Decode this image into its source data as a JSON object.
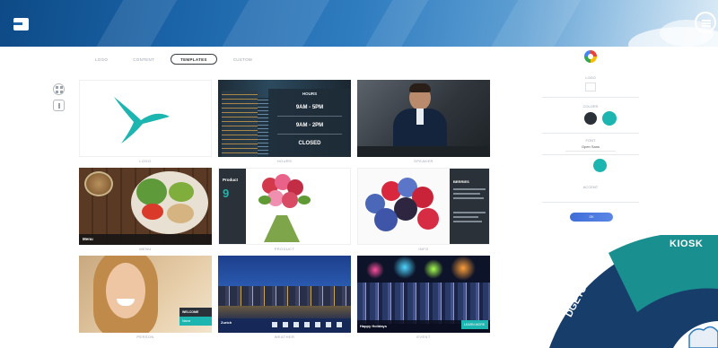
{
  "header": {
    "logo_icon": "app-logo-icon",
    "menu_icon": "hamburger-menu-icon",
    "gradient_start": "#0d4a86",
    "gradient_end": "#dcebf6"
  },
  "tabs": [
    {
      "label": "LOGO",
      "active": false
    },
    {
      "label": "CONTENT",
      "active": false
    },
    {
      "label": "TEMPLATES",
      "active": true
    },
    {
      "label": "CUSTOM",
      "active": false
    }
  ],
  "side_icons": [
    "grid-icon",
    "info-icon"
  ],
  "tiles": [
    {
      "label": "LOGO"
    },
    {
      "label": "HOURS",
      "title": "HOURS",
      "lines": [
        "9AM - 5PM",
        "9AM - 2PM",
        "CLOSED"
      ]
    },
    {
      "label": "SPEAKER"
    },
    {
      "label": "MENU",
      "caption": "Menu"
    },
    {
      "label": "PRODUCT",
      "title": "Product",
      "number": "9"
    },
    {
      "label": "INFO",
      "title": "BERRIES"
    },
    {
      "label": "PERSON",
      "badge_top": "WELCOME",
      "badge_bottom": "Name"
    },
    {
      "label": "WEATHER",
      "caption": "Zurich"
    },
    {
      "label": "EVENT",
      "caption": "Happy Holidays",
      "button": "LEARN MORE"
    }
  ],
  "panel": {
    "color_wheel_icon": "color-wheel-icon",
    "label_logo": "LOGO",
    "label_colors": "COLORS",
    "label_font": "FONT",
    "font_value": "Open Sans",
    "label_accent": "ACCENT",
    "colors": [
      "#2b3138",
      "#1db5b0"
    ],
    "accent_color": "#1db5b0",
    "apply_label": "OK"
  },
  "kiosk": {
    "label_kiosk": "KIOSK",
    "label_widgets": "DGETS",
    "color_teal": "#1a8f8f",
    "color_navy": "#173d6a"
  }
}
